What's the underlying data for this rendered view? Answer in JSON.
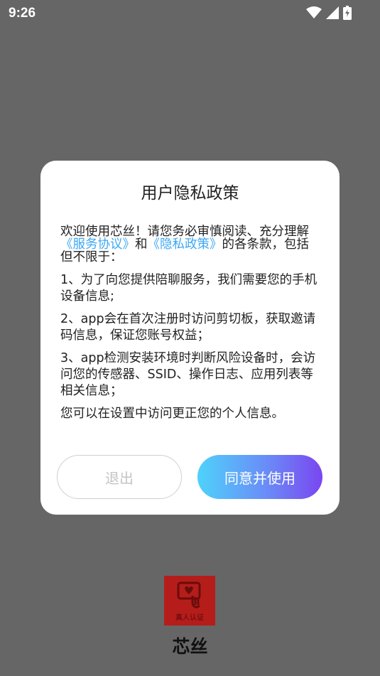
{
  "status_bar": {
    "time": "9:26",
    "icons": [
      "wifi-icon",
      "signal-icon",
      "battery-charging-icon"
    ]
  },
  "dialog": {
    "title": "用户隐私政策",
    "intro": {
      "prefix": "欢迎使用芯丝！请您务必审慎阅读、充分理解",
      "link1": "《服务协议》",
      "middle": "和",
      "link2": "《隐私政策》",
      "suffix": "的各条款，包括但不限于："
    },
    "items": [
      "1、为了向您提供陪聊服务，我们需要您的手机设备信息;",
      "2、app会在首次注册时访问剪切板，获取邀请码信息，保证您账号权益；",
      "3、app检测安装环境时判断风险设备时，会访问您的传感器、SSID、操作日志、应用列表等相关信息；"
    ],
    "closing": "您可以在设置中访问更正您的个人信息。",
    "exit_label": "退出",
    "agree_label": "同意并使用"
  },
  "app": {
    "logo_text": "真人认证",
    "name": "芯丝"
  },
  "colors": {
    "link": "#3ba7f5",
    "agree_gradient_start": "#4fd2fb",
    "agree_gradient_end": "#7a46f0",
    "logo_bg": "#b51d1b"
  }
}
